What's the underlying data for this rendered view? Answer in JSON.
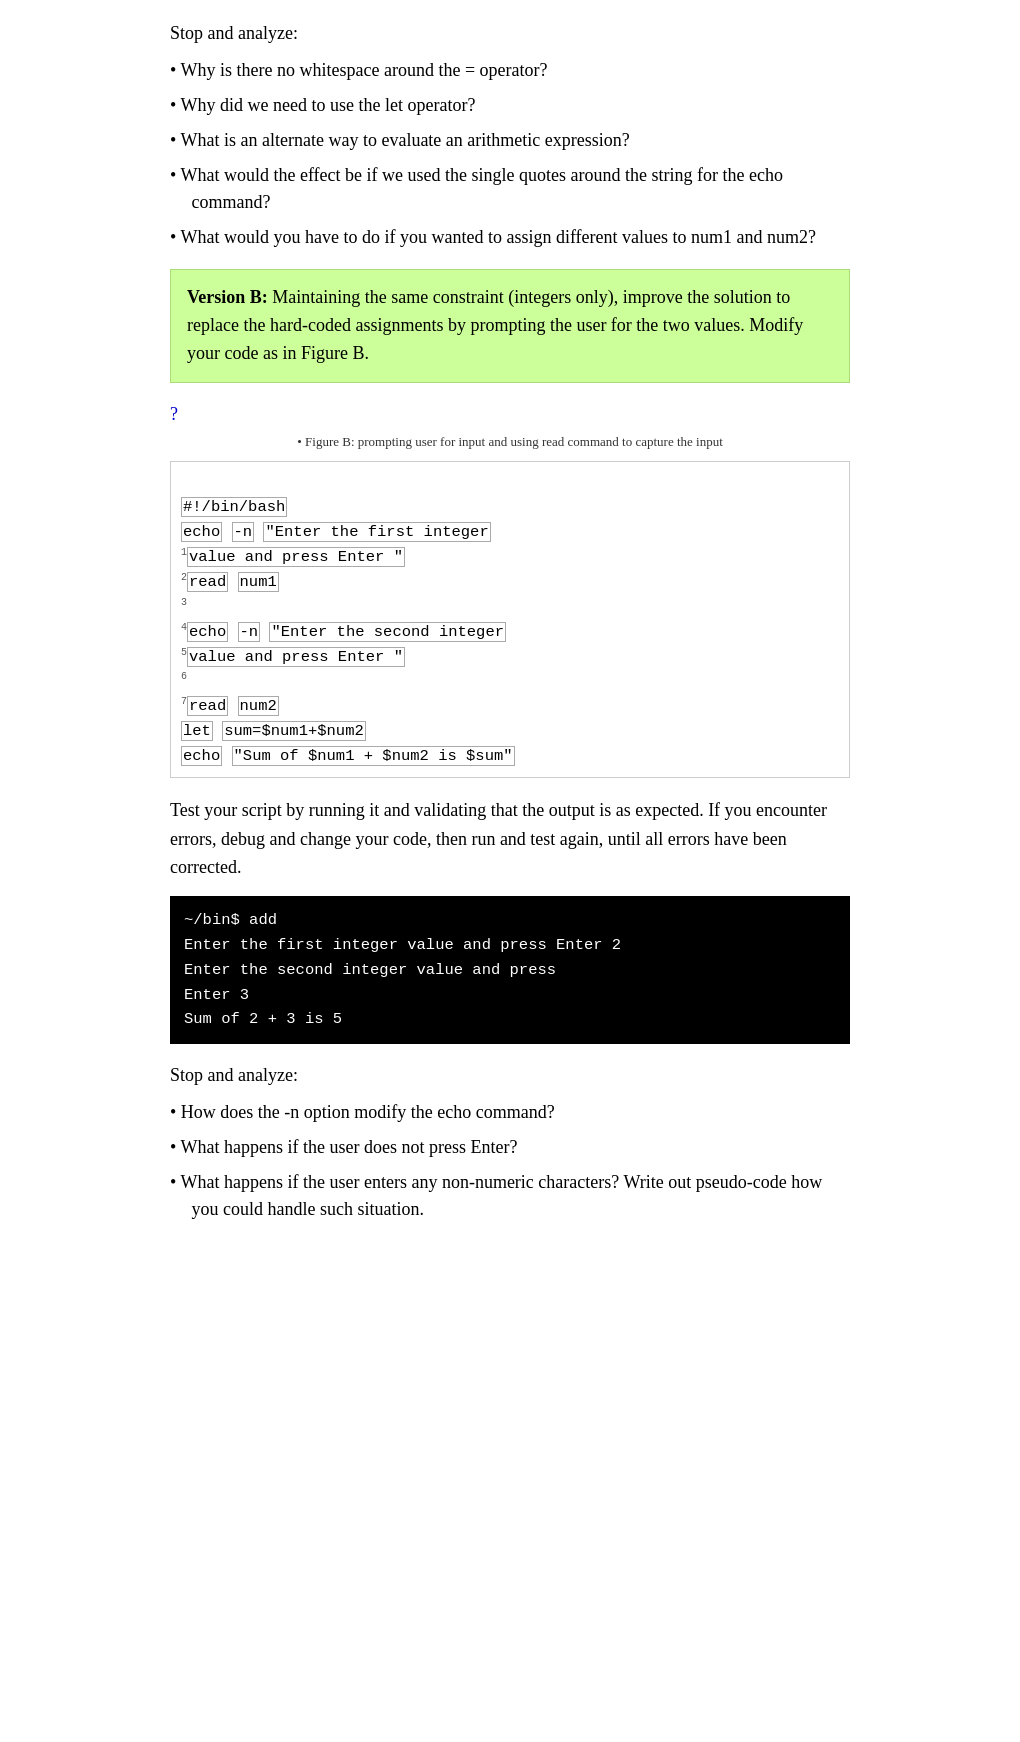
{
  "stop_analyze_1": "Stop and analyze:",
  "bullets_1": [
    "Why is there no whitespace around the = operator?",
    "Why did we need to use the let operator?",
    "What is an alternate way to evaluate an arithmetic expression?",
    "What would the effect be if we used the single quotes around the string for the echo command?",
    "What would you have to do if you wanted to assign different values to num1 and num2?"
  ],
  "version_box": {
    "bold": "Version B:",
    "text": " Maintaining the same constraint (integers only), improve the solution to replace the hard-coded assignments by prompting the user for the two values. Modify your code as in Figure B."
  },
  "figure_link": "?",
  "figure_caption": "• Figure B: prompting user for input and using read command to capture the input",
  "code_lines": [
    {
      "num": "",
      "content": "#!/bin/bash"
    },
    {
      "num": "",
      "content": "echo -n \"Enter the first integer"
    },
    {
      "num": "1",
      "content": "value and press Enter \""
    },
    {
      "num": "2",
      "content": "read num1"
    },
    {
      "num": "3",
      "content": ""
    },
    {
      "num": "4",
      "content": "echo -n \"Enter the second integer"
    },
    {
      "num": "5",
      "content": "value and press Enter \""
    },
    {
      "num": "6",
      "content": ""
    },
    {
      "num": "7",
      "content": "read num2"
    },
    {
      "num": "",
      "content": "let sum=$num1+$num2"
    },
    {
      "num": "",
      "content": "echo \"Sum of $num1 + $num2 is $sum\""
    }
  ],
  "body_text_1": "Test your script by running it and validating that the output is as expected. If you encounter errors, debug and change your code, then run and test again, until all errors have been corrected.",
  "terminal": {
    "line1": "~/bin$ add",
    "line2": "Enter the first integer value and press Enter 2",
    "line3": "Enter the second integer value and press",
    "line4": "Enter 3",
    "line5": "Sum of 2 + 3 is 5"
  },
  "stop_analyze_2": "Stop and analyze:",
  "bullets_2": [
    "How does the -n option modify the echo command?",
    "What happens if the user does not press Enter?",
    "What happens if the user enters any non-numeric characters? Write out pseudo-code how you could handle such situation."
  ]
}
